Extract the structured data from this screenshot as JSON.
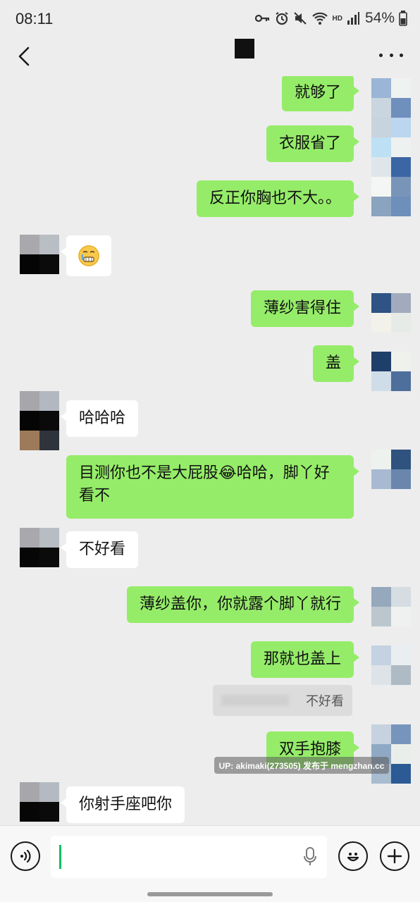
{
  "status_bar": {
    "time": "08:11",
    "battery": "54%",
    "network": "HD"
  },
  "messages": [
    {
      "side": "me",
      "text": "就够了"
    },
    {
      "side": "me",
      "text": "衣服省了"
    },
    {
      "side": "me",
      "text": "反正你胸也不大。。"
    },
    {
      "side": "them",
      "text": "",
      "emoji": "grimacing-tears-emoji"
    },
    {
      "side": "me",
      "text": "薄纱害得住"
    },
    {
      "side": "me",
      "text": "盖"
    },
    {
      "side": "them",
      "text": "哈哈哈"
    },
    {
      "side": "me",
      "text": "目测你也不是大屁股😂哈哈，脚丫好看不"
    },
    {
      "side": "them",
      "text": "不好看"
    },
    {
      "side": "me",
      "text": "薄纱盖你，你就露个脚丫就行"
    },
    {
      "side": "me",
      "text": "那就也盖上",
      "quote": "不好看"
    },
    {
      "side": "me",
      "text": "双手抱膝"
    },
    {
      "side": "them",
      "text": "你射手座吧你"
    }
  ],
  "watermark": "UP: akimaki(273505) 发布于 mengzhan.cc",
  "input_bar": {
    "voice_icon": "voice-toggle-icon",
    "mic_icon": "microphone-icon",
    "emoji_icon": "smiley-icon",
    "plus_icon": "plus-icon"
  },
  "colors": {
    "my_bubble": "#95ec69",
    "their_bubble": "#ffffff",
    "background": "#ededed",
    "caret": "#07c160"
  }
}
